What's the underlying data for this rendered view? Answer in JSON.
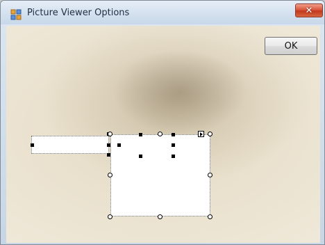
{
  "window": {
    "title": "Picture Viewer Options",
    "close_glyph": "✕",
    "icon": "form-icon"
  },
  "buttons": {
    "ok_label": "OK"
  },
  "designer": {
    "controls": [
      {
        "name": "textbox-left",
        "kind": "textbox",
        "selected": true
      },
      {
        "name": "textbox-middle",
        "kind": "textbox",
        "selected": true
      },
      {
        "name": "picturebox",
        "kind": "picturebox",
        "selected": true,
        "primary": true
      }
    ]
  }
}
